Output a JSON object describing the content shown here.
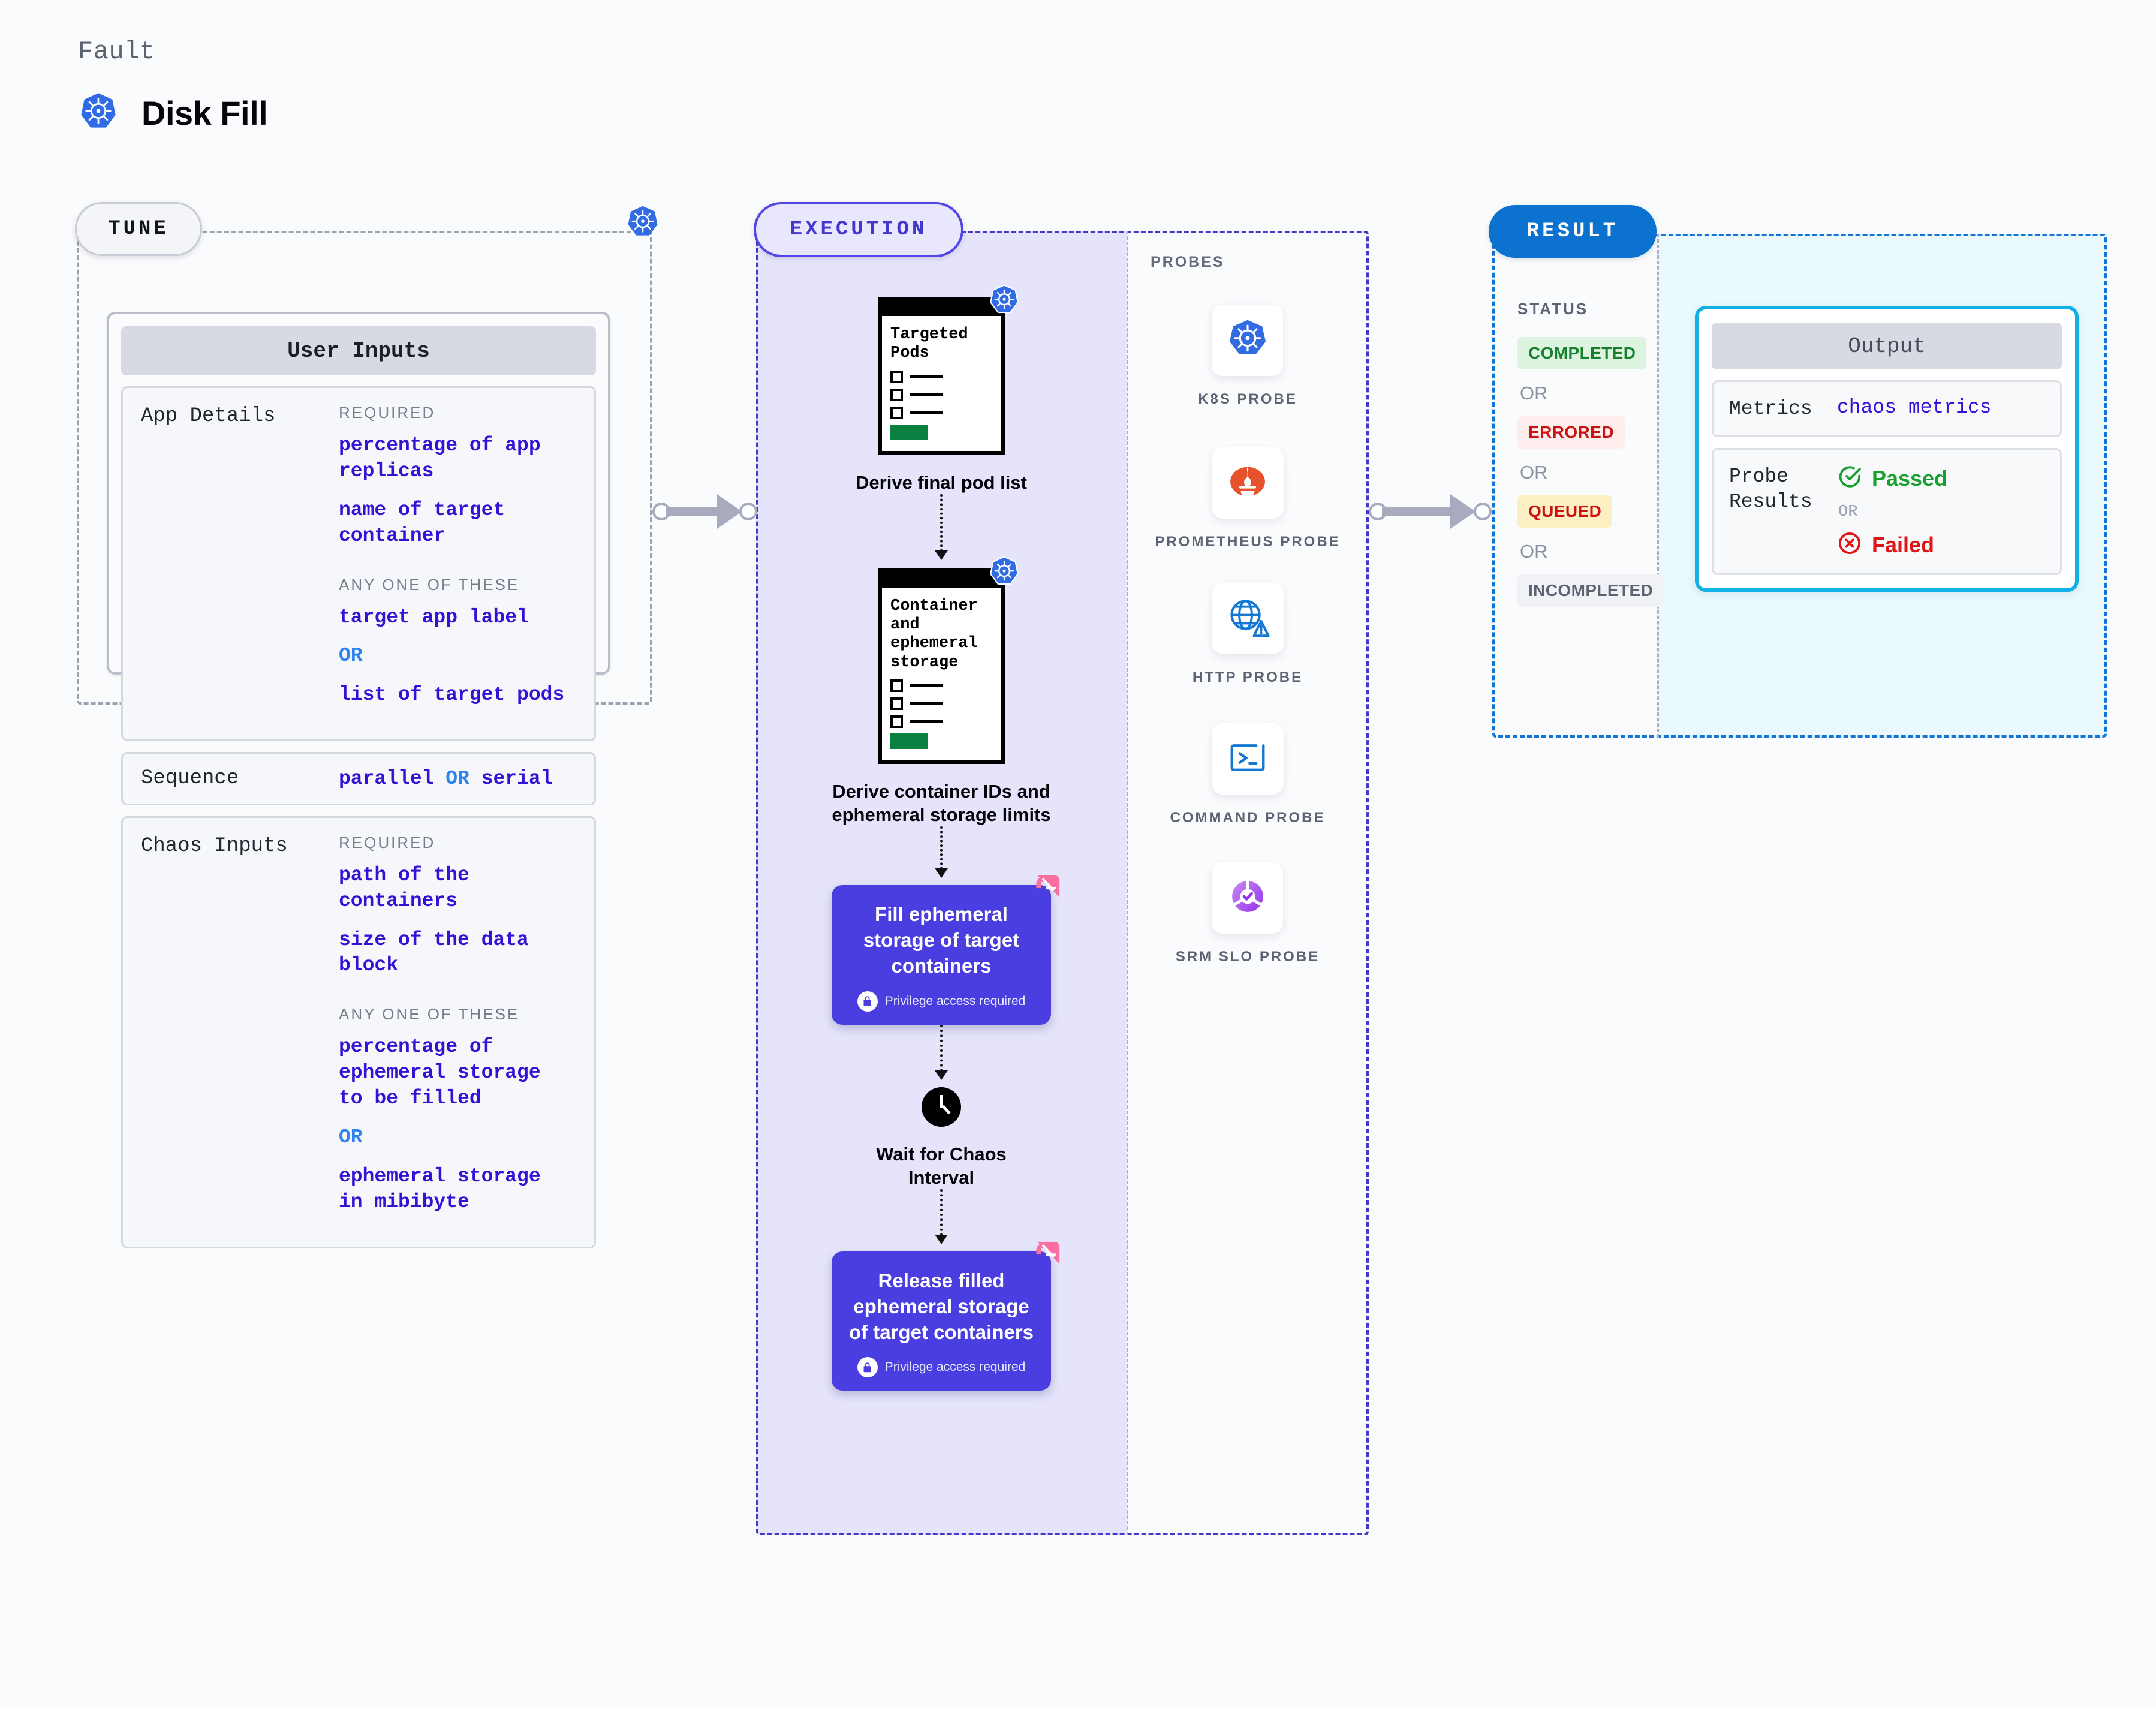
{
  "header": {
    "eyebrow": "Fault",
    "title": "Disk Fill",
    "logo_icon": "kubernetes-icon"
  },
  "tune": {
    "pill_label": "TUNE",
    "badge_icon": "kubernetes-icon",
    "panel_title": "User Inputs",
    "sections": [
      {
        "key": "App Details",
        "groups": [
          {
            "label": "REQUIRED",
            "values": [
              "percentage of app replicas",
              "name of target container"
            ]
          },
          {
            "label": "ANY ONE OF THESE",
            "values": [
              "target app label",
              "OR",
              "list of target pods"
            ]
          }
        ]
      }
    ],
    "sequence": {
      "key": "Sequence",
      "value_a": "parallel",
      "or": "OR",
      "value_b": "serial"
    },
    "chaos": {
      "key": "Chaos Inputs",
      "groups": [
        {
          "label": "REQUIRED",
          "values": [
            "path of the containers",
            "size of the data block"
          ]
        },
        {
          "label": "ANY ONE OF THESE",
          "values": [
            "percentage of ephemeral storage to be filled",
            "OR",
            "ephemeral storage in mibibyte"
          ]
        }
      ]
    }
  },
  "execution": {
    "pill_label": "EXECUTION",
    "steps": [
      {
        "type": "document",
        "doc_title": "Targeted Pods",
        "badge_icon": "kubernetes-icon",
        "label": "Derive final pod list"
      },
      {
        "type": "document",
        "doc_title": "Container and ephemeral storage",
        "badge_icon": "kubernetes-icon",
        "label": "Derive container IDs and ephemeral storage limits"
      },
      {
        "type": "action",
        "title": "Fill ephemeral storage of target containers",
        "note": "Privilege access required",
        "note_icon": "lock-icon",
        "badge_icon": "litmus-icon"
      },
      {
        "type": "wait",
        "icon": "clock-icon",
        "label": "Wait for Chaos Interval"
      },
      {
        "type": "action",
        "title": "Release filled ephemeral storage of target containers",
        "note": "Privilege access required",
        "note_icon": "lock-icon",
        "badge_icon": "litmus-icon"
      }
    ]
  },
  "probes": {
    "label": "PROBES",
    "items": [
      {
        "name": "K8S PROBE",
        "icon": "kubernetes-icon"
      },
      {
        "name": "PROMETHEUS PROBE",
        "icon": "prometheus-icon"
      },
      {
        "name": "HTTP PROBE",
        "icon": "globe-warning-icon"
      },
      {
        "name": "COMMAND PROBE",
        "icon": "terminal-icon"
      },
      {
        "name": "SRM SLO PROBE",
        "icon": "slo-donut-check-icon"
      }
    ]
  },
  "result": {
    "pill_label": "RESULT",
    "status_label": "STATUS",
    "or_label": "OR",
    "statuses": [
      {
        "text": "COMPLETED",
        "color": "#16802d",
        "bg": "#ddf5e0"
      },
      {
        "text": "ERRORED",
        "color": "#cc1111",
        "bg": "#fdeeed"
      },
      {
        "text": "QUEUED",
        "color": "#cc1111",
        "bg": "#fcefc3"
      },
      {
        "text": "INCOMPLETED",
        "color": "#5d6373",
        "bg": "#f1f2f6"
      }
    ],
    "output": {
      "title": "Output",
      "metrics_key": "Metrics",
      "metrics_value": "chaos metrics",
      "probe_results_key": "Probe Results",
      "passed": "Passed",
      "passed_icon": "check-circle-icon",
      "or": "OR",
      "failed": "Failed",
      "failed_icon": "x-circle-icon"
    }
  },
  "colors": {
    "accent_purple": "#4a3ee0",
    "accent_blue": "#0b72cf",
    "k8s_blue": "#326ce5",
    "litmus_pink": "#fb6fa0",
    "value_blue": "#3213d6"
  }
}
